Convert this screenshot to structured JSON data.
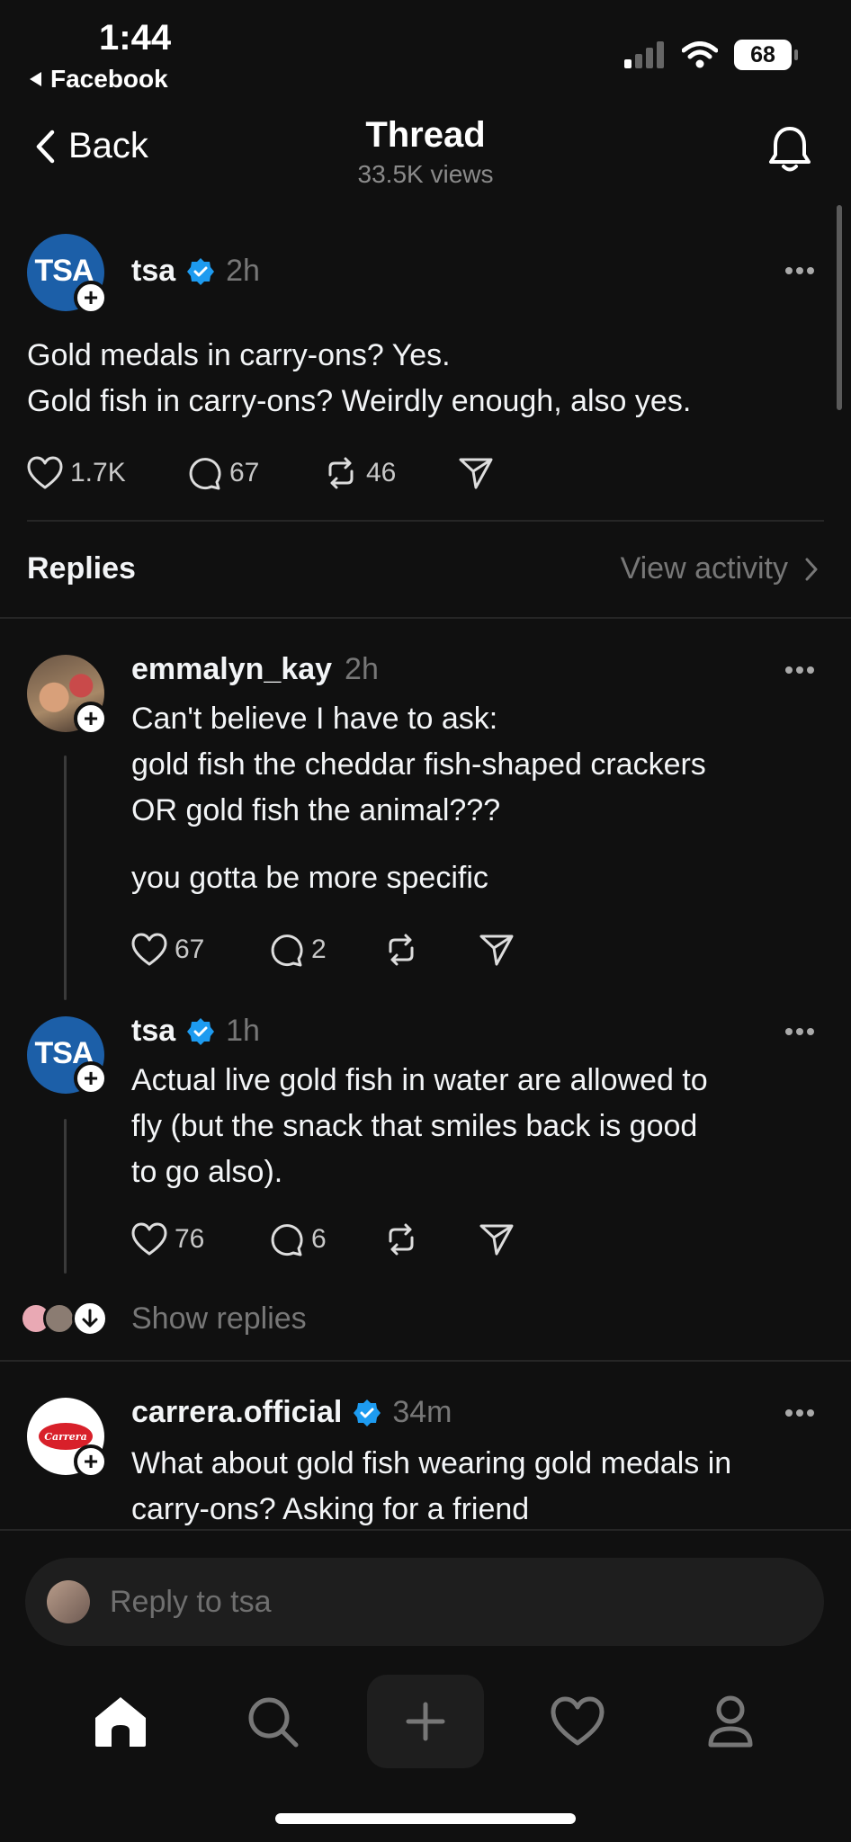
{
  "status_bar": {
    "time": "1:44",
    "back_app": "Facebook",
    "battery": "68"
  },
  "header": {
    "back_label": "Back",
    "title": "Thread",
    "views": "33.5K views"
  },
  "main_post": {
    "avatar_text": "TSA",
    "username": "tsa",
    "time": "2h",
    "text_line1": "Gold medals in carry-ons? Yes.",
    "text_line2": "Gold fish in carry-ons? Weirdly enough, also yes.",
    "likes": "1.7K",
    "comments": "67",
    "reposts": "46"
  },
  "replies_header": {
    "label": "Replies",
    "view_activity": "View activity"
  },
  "replies": [
    {
      "username": "emmalyn_kay",
      "time": "2h",
      "line1": "Can't believe I have to ask:",
      "line2": "gold fish the cheddar fish-shaped crackers",
      "line3": "OR gold fish the animal???",
      "line4": "you gotta be more specific",
      "likes": "67",
      "comments": "2"
    },
    {
      "avatar_text": "TSA",
      "username": "tsa",
      "time": "1h",
      "line1": "Actual live gold fish in water are allowed to",
      "line2": "fly (but the snack that smiles back is good",
      "line3": "to go also).",
      "likes": "76",
      "comments": "6"
    },
    {
      "username": "carrera.official",
      "avatar_text": "Carrera",
      "time": "34m",
      "line1": "What about gold fish wearing gold medals in",
      "line2": "carry-ons? Asking for a friend"
    }
  ],
  "show_replies": "Show replies",
  "composer": {
    "placeholder": "Reply to tsa"
  },
  "colors": {
    "background": "#101010",
    "verified": "#1d9bf0",
    "tsa_blue": "#1c5fa8"
  }
}
